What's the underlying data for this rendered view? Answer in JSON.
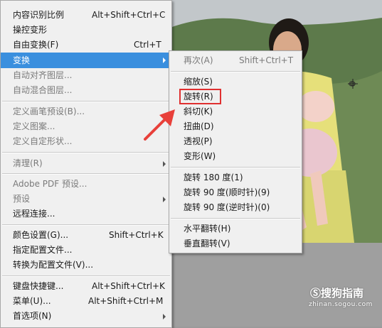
{
  "main_menu": {
    "items": [
      {
        "label": "内容识别比例",
        "shortcut": "Alt+Shift+Ctrl+C",
        "enabled": true
      },
      {
        "label": "操控变形",
        "shortcut": "",
        "enabled": true
      },
      {
        "label": "自由变换(F)",
        "shortcut": "Ctrl+T",
        "enabled": true
      },
      {
        "label": "变换",
        "shortcut": "",
        "enabled": true,
        "active": true
      },
      {
        "label": "自动对齐图层...",
        "shortcut": "",
        "enabled": false
      },
      {
        "label": "自动混合图层...",
        "shortcut": "",
        "enabled": false
      },
      {
        "label": "定义画笔预设(B)...",
        "shortcut": "",
        "enabled": false
      },
      {
        "label": "定义图案...",
        "shortcut": "",
        "enabled": false
      },
      {
        "label": "定义自定形状...",
        "shortcut": "",
        "enabled": false
      },
      {
        "label": "清理(R)",
        "shortcut": "",
        "enabled": false
      },
      {
        "label": "Adobe PDF 预设...",
        "shortcut": "",
        "enabled": false
      },
      {
        "label": "预设",
        "shortcut": "",
        "enabled": false
      },
      {
        "label": "远程连接...",
        "shortcut": "",
        "enabled": true
      },
      {
        "label": "颜色设置(G)...",
        "shortcut": "Shift+Ctrl+K",
        "enabled": true
      },
      {
        "label": "指定配置文件...",
        "shortcut": "",
        "enabled": true
      },
      {
        "label": "转换为配置文件(V)...",
        "shortcut": "",
        "enabled": true
      },
      {
        "label": "键盘快捷键...",
        "shortcut": "Alt+Shift+Ctrl+K",
        "enabled": true
      },
      {
        "label": "菜单(U)...",
        "shortcut": "Alt+Shift+Ctrl+M",
        "enabled": true
      },
      {
        "label": "首选项(N)",
        "shortcut": "",
        "enabled": true
      }
    ]
  },
  "transform_submenu": {
    "items": [
      {
        "label": "再次(A)",
        "shortcut": "Shift+Ctrl+T",
        "enabled": false
      },
      {
        "label": "缩放(S)",
        "shortcut": "",
        "enabled": true
      },
      {
        "label": "旋转(R)",
        "shortcut": "",
        "enabled": true,
        "highlighted": true
      },
      {
        "label": "斜切(K)",
        "shortcut": "",
        "enabled": true
      },
      {
        "label": "扭曲(D)",
        "shortcut": "",
        "enabled": true
      },
      {
        "label": "透视(P)",
        "shortcut": "",
        "enabled": true
      },
      {
        "label": "变形(W)",
        "shortcut": "",
        "enabled": true
      },
      {
        "label": "旋转 180 度(1)",
        "shortcut": "",
        "enabled": true
      },
      {
        "label": "旋转 90 度(顺时针)(9)",
        "shortcut": "",
        "enabled": true
      },
      {
        "label": "旋转 90 度(逆时针)(0)",
        "shortcut": "",
        "enabled": true
      },
      {
        "label": "水平翻转(H)",
        "shortcut": "",
        "enabled": true
      },
      {
        "label": "垂直翻转(V)",
        "shortcut": "",
        "enabled": true
      }
    ]
  },
  "watermark": {
    "title": "Ⓢ搜狗指南",
    "url": "zhinan.sogou.com"
  },
  "colors": {
    "active": "#3a8fde",
    "highlight_box": "#e03030",
    "annotation_arrow": "#e8403a"
  },
  "icons": {
    "submenu_arrow": "chevron-right-icon",
    "anchor": "transform-anchor-icon",
    "annotation": "red-annotation-arrow"
  }
}
